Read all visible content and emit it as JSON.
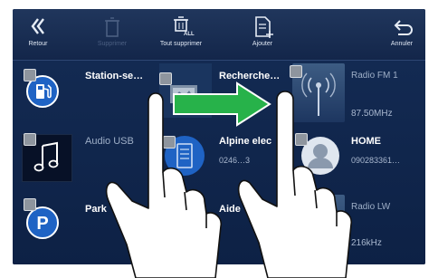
{
  "toolbar": {
    "back_label": "Retour",
    "delete_label": "Supprimer",
    "delete_all_label": "Tout supprimer",
    "delete_all_icon_text": "ALL",
    "add_label": "Ajouter",
    "cancel_label": "Annuler"
  },
  "tiles": [
    {
      "name": "Station-se…",
      "sub": "",
      "icon": "fuel-station-icon"
    },
    {
      "name": "Recherche…",
      "sub": "",
      "icon": "map-photo-icon"
    },
    {
      "name": "Radio FM 1",
      "sub": "87.50MHz",
      "icon": "radio-antenna-icon"
    },
    {
      "name": "Audio USB",
      "sub": "",
      "icon": "music-note-icon"
    },
    {
      "name": "Alpine elec",
      "sub": "0246…3",
      "icon": "document-icon"
    },
    {
      "name": "HOME",
      "sub": "090283361…",
      "icon": "contact-person-icon"
    },
    {
      "name": "Park",
      "sub": "",
      "icon": "parking-icon"
    },
    {
      "name": "Aide",
      "sub": "",
      "icon": "help-icon"
    },
    {
      "name": "Radio LW",
      "sub": "216kHz",
      "icon": "radio-icon"
    }
  ],
  "colors": {
    "toolbar_bg": "#1a2f56",
    "grid_bg": "#102649",
    "accent_blue": "#1f63c4",
    "arrow_green": "#27b24a"
  }
}
